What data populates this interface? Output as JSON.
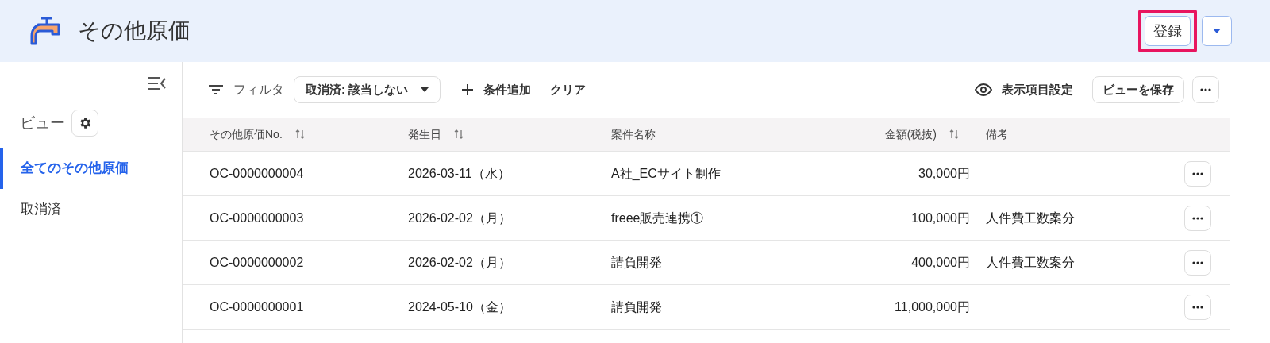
{
  "header": {
    "title": "その他原価",
    "primary_button": "登録",
    "highlighted": true
  },
  "sidebar": {
    "views_label": "ビュー",
    "items": [
      {
        "label": "全てのその他原価",
        "selected": true
      },
      {
        "label": "取消済",
        "selected": false
      }
    ]
  },
  "toolbar": {
    "filter_label": "フィルタ",
    "filter_chip": "取消済: 該当しない",
    "add_condition": "条件追加",
    "clear": "クリア",
    "column_settings": "表示項目設定",
    "save_view": "ビューを保存"
  },
  "table": {
    "columns": [
      {
        "label": "その他原価No.",
        "sortable": true
      },
      {
        "label": "発生日",
        "sortable": true
      },
      {
        "label": "案件名称",
        "sortable": false
      },
      {
        "label": "金額(税抜)",
        "sortable": true
      },
      {
        "label": "備考",
        "sortable": false
      }
    ],
    "rows": [
      [
        "OC-0000000004",
        "2026-03-11（水）",
        "A社_ECサイト制作",
        "30,000円",
        ""
      ],
      [
        "OC-0000000003",
        "2026-02-02（月）",
        "freee販売連携①",
        "100,000円",
        "人件費工数案分"
      ],
      [
        "OC-0000000002",
        "2026-02-02（月）",
        "請負開発",
        "400,000円",
        "人件費工数案分"
      ],
      [
        "OC-0000000001",
        "2024-05-10（金）",
        "請負開発",
        "11,000,000円",
        ""
      ]
    ]
  }
}
